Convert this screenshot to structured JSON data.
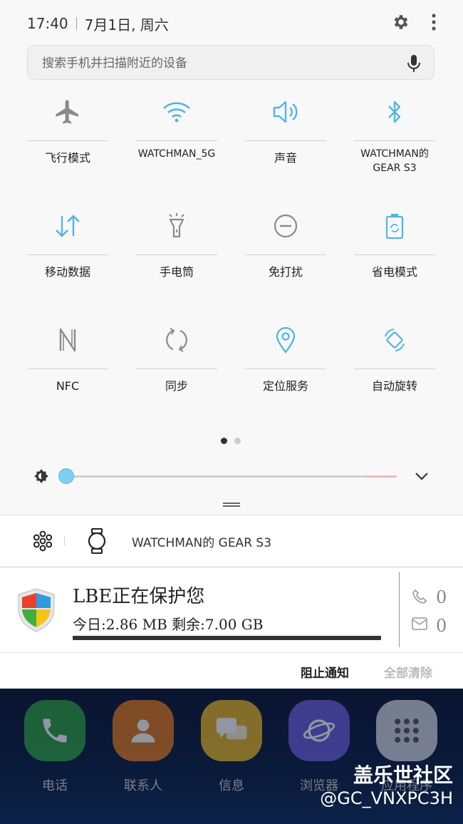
{
  "status_bar": {
    "time": "17:40",
    "date": "7月1日, 周六"
  },
  "search": {
    "placeholder": "搜索手机并扫描附近的设备"
  },
  "tiles": [
    {
      "label": "飞行模式",
      "icon": "airplane-icon",
      "active": false
    },
    {
      "label": "WATCHMAN_5G",
      "icon": "wifi-icon",
      "active": true
    },
    {
      "label": "声音",
      "icon": "speaker-icon",
      "active": true
    },
    {
      "label": "WATCHMAN的 GEAR S3",
      "icon": "bluetooth-icon",
      "active": true
    },
    {
      "label": "移动数据",
      "icon": "mobile-data-icon",
      "active": true
    },
    {
      "label": "手电筒",
      "icon": "flashlight-icon",
      "active": false
    },
    {
      "label": "免打扰",
      "icon": "do-not-disturb-icon",
      "active": false
    },
    {
      "label": "省电模式",
      "icon": "battery-saver-icon",
      "active": true
    },
    {
      "label": "NFC",
      "icon": "nfc-icon",
      "active": false
    },
    {
      "label": "同步",
      "icon": "sync-icon",
      "active": false
    },
    {
      "label": "定位服务",
      "icon": "location-icon",
      "active": true
    },
    {
      "label": "自动旋转",
      "icon": "auto-rotate-icon",
      "active": true
    }
  ],
  "pager": {
    "current": 1,
    "total": 2
  },
  "brightness": {
    "level": 0.0
  },
  "wear_notification": {
    "text": "WATCHMAN的 GEAR S3"
  },
  "lbe": {
    "title": "LBE正在保护您",
    "usage": "今日:2.86 MB 剩余:7.00 GB",
    "call_count": "0",
    "sms_count": "0"
  },
  "actions": {
    "block": "阻止通知",
    "clear_all": "全部清除"
  },
  "dock": [
    {
      "label": "电话",
      "icon": "phone-icon",
      "color": "#2e9e3e"
    },
    {
      "label": "联系人",
      "icon": "contacts-icon",
      "color": "#e0781c"
    },
    {
      "label": "信息",
      "icon": "messages-icon",
      "color": "#e8b422"
    },
    {
      "label": "浏览器",
      "icon": "browser-icon",
      "color": "#6a5bd8"
    },
    {
      "label": "应用程序",
      "icon": "apps-icon",
      "color": "#cfd3da"
    }
  ],
  "watermark": {
    "site": "盖乐世社区",
    "handle": "@GC_VNXPC3H"
  },
  "colors": {
    "accent": "#4fb6e2",
    "inactive": "#8a8a8a"
  }
}
